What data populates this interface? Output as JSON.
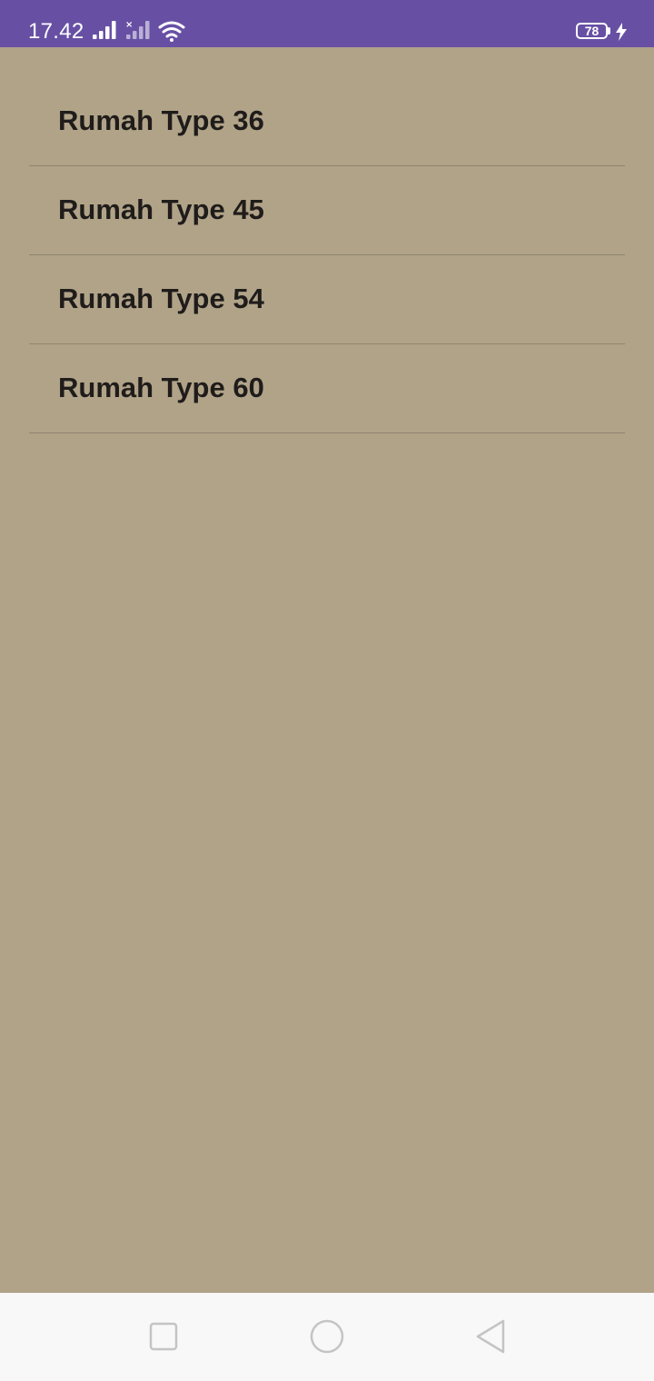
{
  "status_bar": {
    "time": "17.42",
    "battery_level": "78",
    "bg_color": "#6750a4",
    "icons": [
      "signal-icon",
      "signal-no-service-icon",
      "wifi-icon",
      "battery-icon",
      "charging-bolt-icon"
    ]
  },
  "list": {
    "bg_color": "#b0a388",
    "items": [
      {
        "label": "Rumah Type 36"
      },
      {
        "label": "Rumah Type 45"
      },
      {
        "label": "Rumah Type 54"
      },
      {
        "label": "Rumah Type 60"
      }
    ]
  },
  "nav_bar": {
    "buttons": [
      "recent-apps-icon",
      "home-icon",
      "back-icon"
    ]
  }
}
